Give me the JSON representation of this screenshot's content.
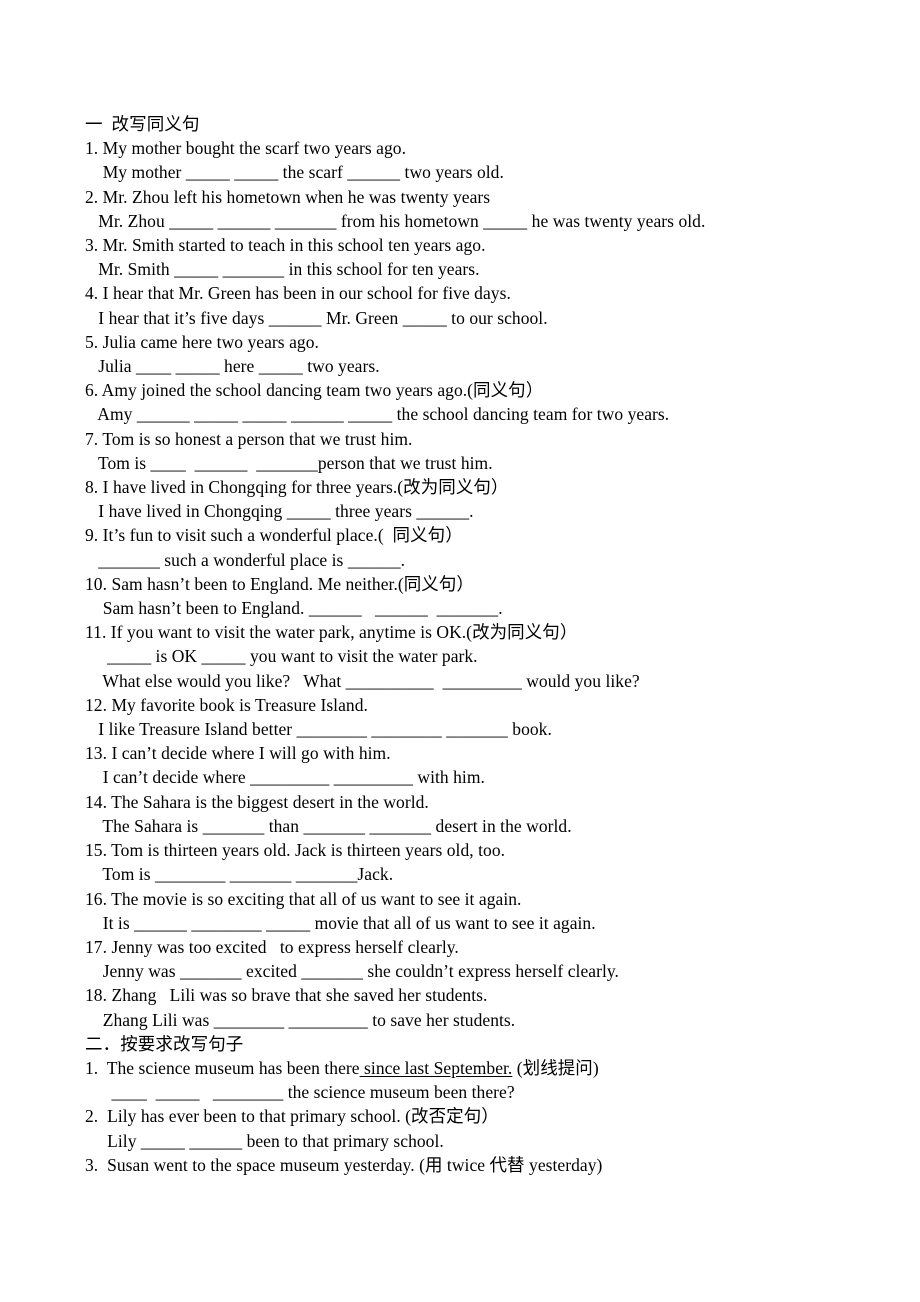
{
  "document": {
    "sections": [
      {
        "id": "section-one",
        "heading": "一  改写同义句",
        "items": [
          {
            "prompt": "1. My mother bought the scarf two years ago.",
            "answer": "    My mother _____ _____ the scarf ______ two years old."
          },
          {
            "prompt": "2. Mr. Zhou left his hometown when he was twenty years",
            "answer": "   Mr. Zhou _____ ______ _______ from his hometown _____ he was twenty years old."
          },
          {
            "prompt": "3. Mr. Smith started to teach in this school ten years ago.",
            "answer": "   Mr. Smith _____ _______ in this school for ten years."
          },
          {
            "prompt": "4. I hear that Mr. Green has been in our school for five days.",
            "answer": "   I hear that it’s five days ______ Mr. Green _____ to our school."
          },
          {
            "prompt": "5. Julia came here two years ago.",
            "answer": "   Julia ____ _____ here _____ two years."
          },
          {
            "prompt": "6. Amy joined the school dancing team two years ago.(同义句）",
            "answer": "   Amy ______ _____ _____ ______ _____ the school dancing team for two years."
          },
          {
            "prompt": "7. Tom is so honest a person that we trust him.",
            "answer": "   Tom is ____  ______  _______person that we trust him."
          },
          {
            "prompt": "8. I have lived in Chongqing for three years.(改为同义句）",
            "answer": "   I have lived in Chongqing _____ three years ______."
          },
          {
            "prompt": "9. It’s fun to visit such a wonderful place.(  同义句）",
            "answer": "   _______ such a wonderful place is ______."
          },
          {
            "prompt": "10. Sam hasn’t been to England. Me neither.(同义句）",
            "answer": "    Sam hasn’t been to England. ______   ______  _______."
          },
          {
            "prompt": "11. If you want to visit the water park, anytime is OK.(改为同义句）",
            "answer": "     _____ is OK _____ you want to visit the water park.",
            "answer2": "    What else would you like?   What __________  _________ would you like?"
          },
          {
            "prompt": "12. My favorite book is Treasure Island.",
            "answer": "   I like Treasure Island better ________ ________ _______ book."
          },
          {
            "prompt": "13. I can’t decide where I will go with him.",
            "answer": "    I can’t decide where _________ _________ with him."
          },
          {
            "prompt": "14. The Sahara is the biggest desert in the world.",
            "answer": "    The Sahara is _______ than _______ _______ desert in the world."
          },
          {
            "prompt": "15. Tom is thirteen years old. Jack is thirteen years old, too.",
            "answer": "    Tom is ________ _______ _______Jack."
          },
          {
            "prompt": "16. The movie is so exciting that all of us want to see it again.",
            "answer": "    It is ______ ________ _____ movie that all of us want to see it again."
          },
          {
            "prompt": "17. Jenny was too excited   to express herself clearly.",
            "answer": "    Jenny was _______ excited _______ she couldn’t express herself clearly."
          },
          {
            "prompt": "18. Zhang   Lili was so brave that she saved her students.",
            "answer": "    Zhang Lili was ________ _________ to save her students."
          }
        ]
      },
      {
        "id": "section-two",
        "heading": "二．按要求改写句子",
        "items": [
          {
            "prompt_pre": "1.  The science museum has been there",
            "prompt_underlined": " since last September.",
            "prompt_post": " (划线提问)",
            "answer": "      ____  _____   ________ the science museum been there?"
          },
          {
            "prompt": "2.  Lily has ever been to that primary school. (改否定句）",
            "answer": "     Lily _____ ______ been to that primary school."
          },
          {
            "prompt": "3.  Susan went to the space museum yesterday. (用 twice 代替 yesterday)",
            "answer": ""
          }
        ]
      }
    ]
  }
}
